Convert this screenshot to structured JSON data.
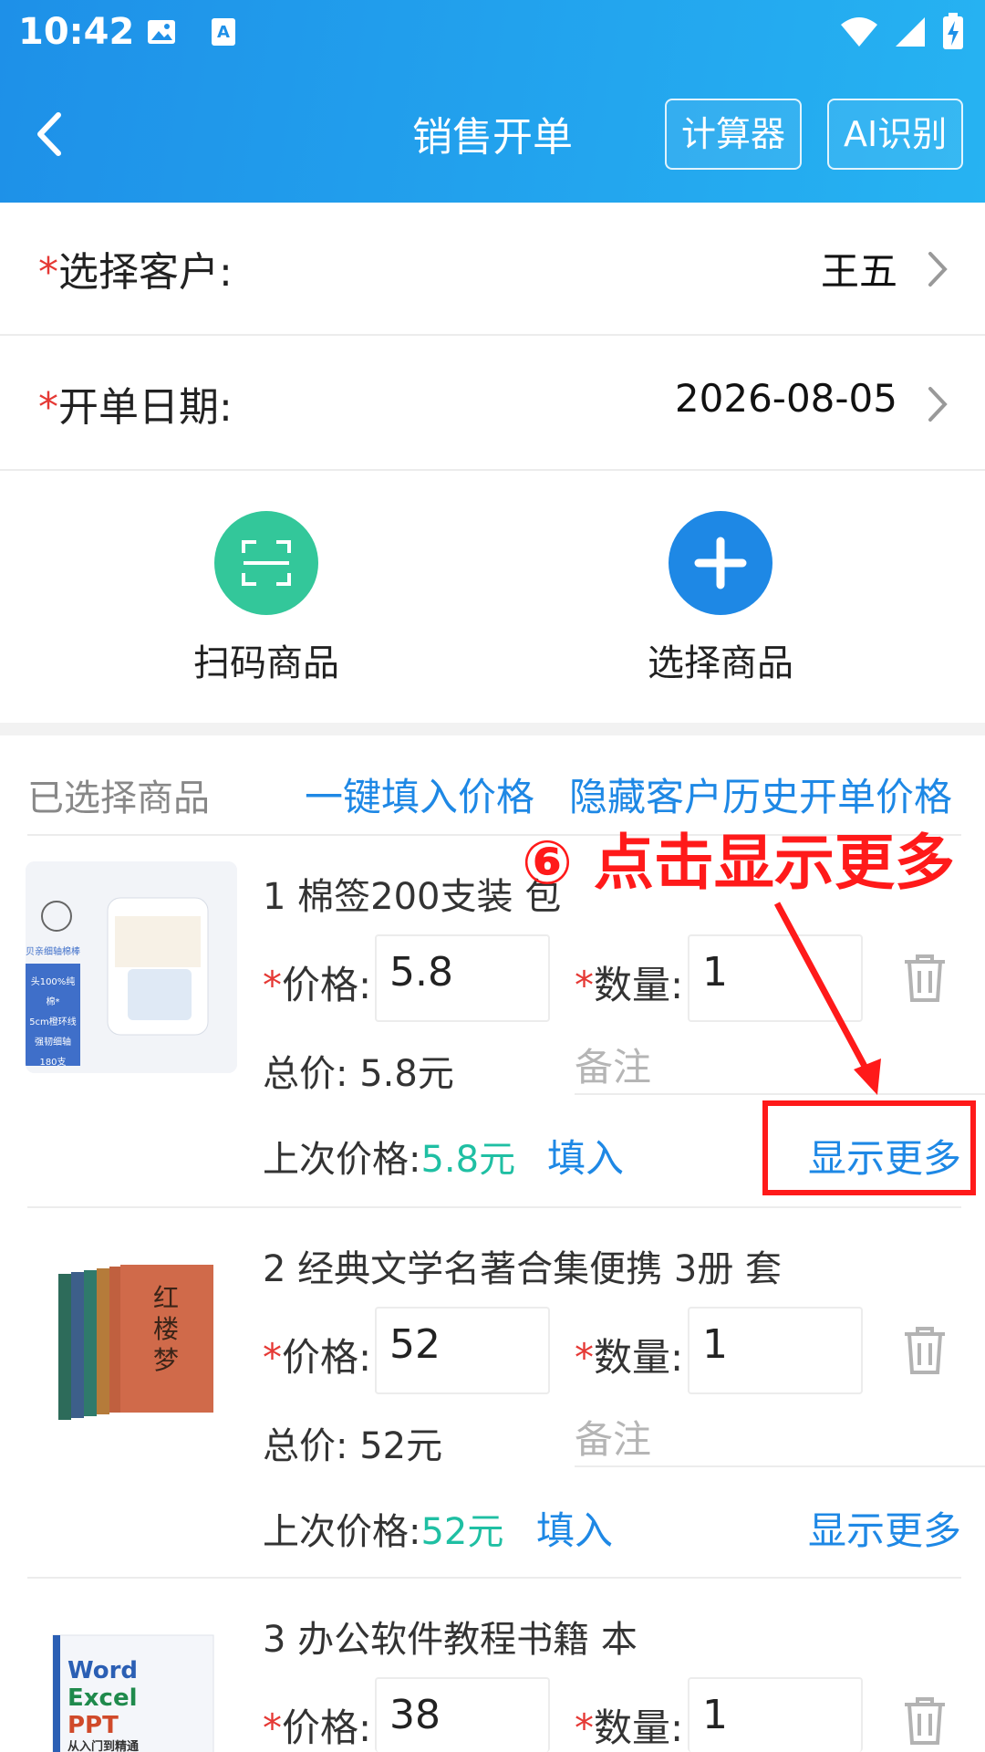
{
  "status_bar": {
    "time": "10:42",
    "icons": [
      "image-icon",
      "app-a-icon",
      "wifi-icon",
      "signal-icon",
      "battery-charging-icon"
    ]
  },
  "header": {
    "title": "销售开单",
    "calculator_label": "计算器",
    "ai_label": "AI识别"
  },
  "form": {
    "customer": {
      "star": "*",
      "label": "选择客户:",
      "value": "王五"
    },
    "date": {
      "star": "*",
      "label": "开单日期:",
      "value": "2026-08-05"
    }
  },
  "actions": {
    "scan_label": "扫码商品",
    "select_label": "选择商品"
  },
  "section": {
    "title": "已选择商品",
    "fill_all_price": "一键填入价格",
    "hide_history": "隐藏客户历史开单价格"
  },
  "annotation": {
    "text": "⑥ 点击显示更多"
  },
  "labels": {
    "price": "价格:",
    "qty": "数量:",
    "total_prefix": "总价:",
    "note_placeholder": "备注",
    "last_price_prefix": "上次价格:",
    "fill": "填入",
    "show_more": "显示更多",
    "star": "*"
  },
  "products": [
    {
      "name": "1 棉签200支装 包",
      "price": "5.8",
      "qty": "1",
      "total": "5.8元",
      "last_price": "5.8元",
      "thumb_lines": [
        "贝亲细轴棉棒",
        "头100%纯棉*",
        "5cm橙环线",
        "强韧细轴",
        "180支"
      ]
    },
    {
      "name": "2 经典文学名著合集便携 3册 套",
      "price": "52",
      "qty": "1",
      "total": "52元",
      "last_price": "52元",
      "thumb_title": "红楼梦"
    },
    {
      "name": "3 办公软件教程书籍 本",
      "price": "38",
      "qty": "1",
      "thumb_lines": [
        "Word",
        "Excel",
        "PPT",
        "从入门到精通"
      ]
    }
  ],
  "colors": {
    "appbar_start": "#1e90e8",
    "appbar_end": "#26b3f2",
    "scan_green": "#33c79a",
    "add_blue": "#1e88e5",
    "link_blue": "#1e88e5",
    "required_red": "#e53935",
    "last_price_teal": "#1fbfa3",
    "annotation_red": "#ff1a1a"
  }
}
